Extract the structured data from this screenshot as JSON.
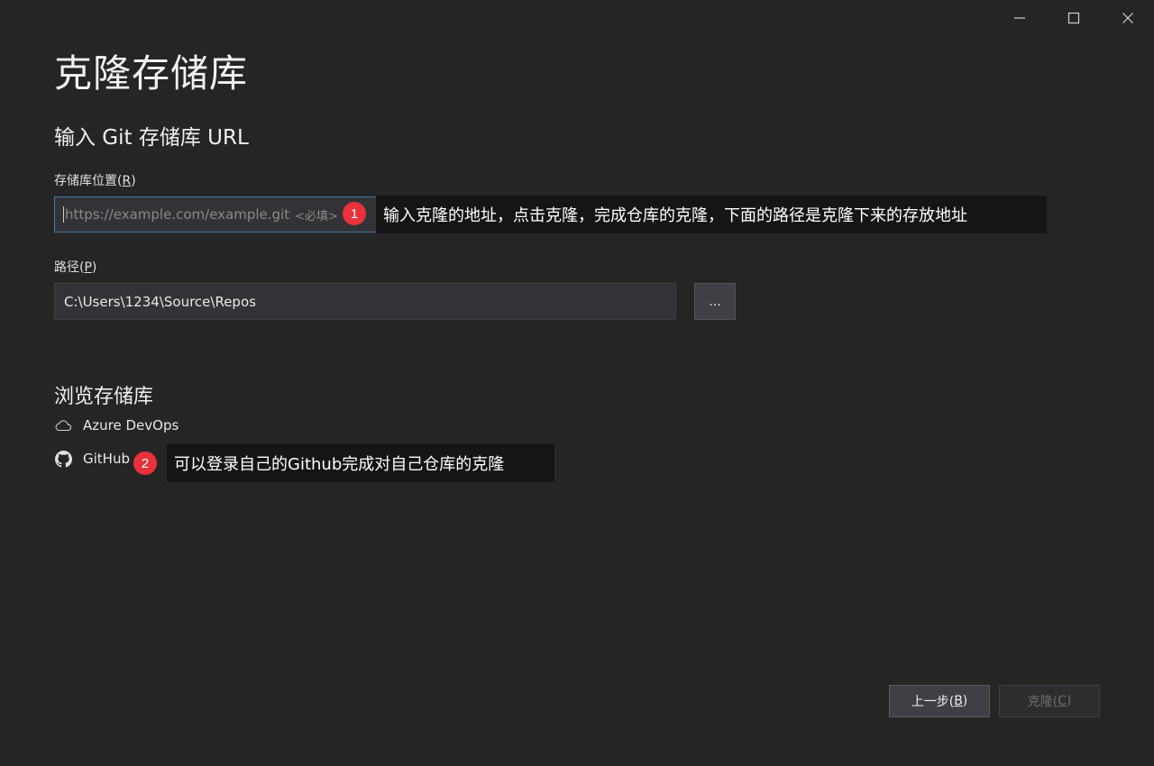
{
  "window": {
    "minimize_icon": "minimize-icon",
    "maximize_icon": "maximize-icon",
    "close_icon": "close-icon"
  },
  "title": "克隆存储库",
  "section_title": "输入 Git 存储库 URL",
  "repo_location": {
    "label_prefix": "存储库位置(",
    "label_key": "R",
    "label_suffix": ")",
    "placeholder": "https://example.com/example.git",
    "required_hint": "<必填>"
  },
  "path": {
    "label_prefix": "路径(",
    "label_key": "P",
    "label_suffix": ")",
    "value": "C:\\Users\\1234\\Source\\Repos",
    "browse_label": "..."
  },
  "browse": {
    "title": "浏览存储库",
    "items": [
      {
        "label": "Azure DevOps",
        "icon": "cloud-icon"
      },
      {
        "label": "GitHub",
        "icon": "github-icon"
      }
    ]
  },
  "annotations": [
    {
      "number": "1",
      "text": "输入克隆的地址，点击克隆，完成仓库的克隆，下面的路径是克隆下来的存放地址"
    },
    {
      "number": "2",
      "text": "可以登录自己的Github完成对自己仓库的克隆"
    }
  ],
  "footer": {
    "back_prefix": "上一步(",
    "back_key": "B",
    "back_suffix": ")",
    "clone_prefix": "克隆(",
    "clone_key": "C",
    "clone_suffix": ")"
  },
  "colors": {
    "background": "#252526",
    "input_focus_border": "#3c7fb1",
    "badge": "#e8313a"
  }
}
